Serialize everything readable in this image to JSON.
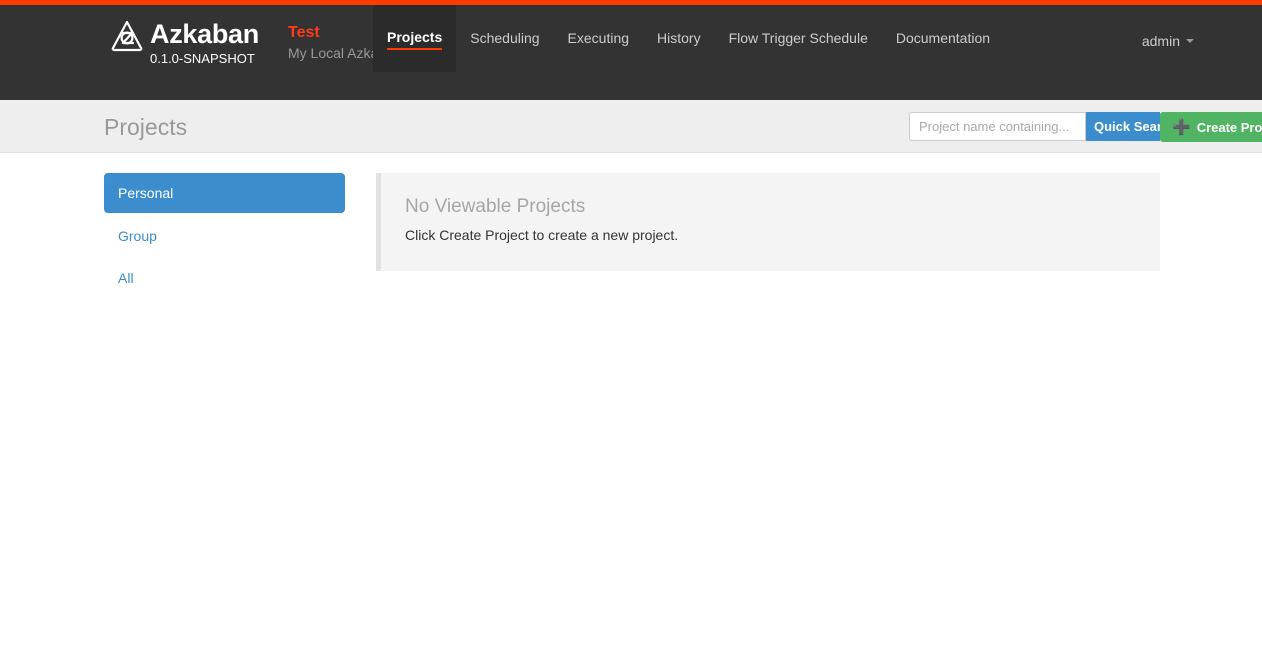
{
  "brand": {
    "logo_icon": "azkaban-triangle-logo",
    "name": "Azkaban",
    "version": "0.1.0-SNAPSHOT",
    "label": "Test",
    "tagline": "My Local Azkaban",
    "label_color": "#ff3b18",
    "accent_color": "#ff3b00"
  },
  "nav": {
    "items": [
      {
        "label": "Projects",
        "active": true
      },
      {
        "label": "Scheduling",
        "active": false
      },
      {
        "label": "Executing",
        "active": false
      },
      {
        "label": "History",
        "active": false
      },
      {
        "label": "Flow Trigger Schedule",
        "active": false
      },
      {
        "label": "Documentation",
        "active": false
      }
    ],
    "user": {
      "name": "admin",
      "caret_icon": "chevron-down-icon"
    }
  },
  "page_header": {
    "title": "Projects",
    "search": {
      "value": "",
      "placeholder": "Project name containing...",
      "button_label": "Quick Search",
      "button_color": "#3c8dcd"
    },
    "create_button": {
      "label": "Create Project",
      "icon": "plus-icon",
      "color": "#51b364"
    }
  },
  "sidebar": {
    "items": [
      {
        "label": "Personal",
        "active": true
      },
      {
        "label": "Group",
        "active": false
      },
      {
        "label": "All",
        "active": false
      }
    ],
    "active_color": "#3c8dcd"
  },
  "main": {
    "empty_state": {
      "title": "No Viewable Projects",
      "message": "Click Create Project to create a new project."
    }
  }
}
